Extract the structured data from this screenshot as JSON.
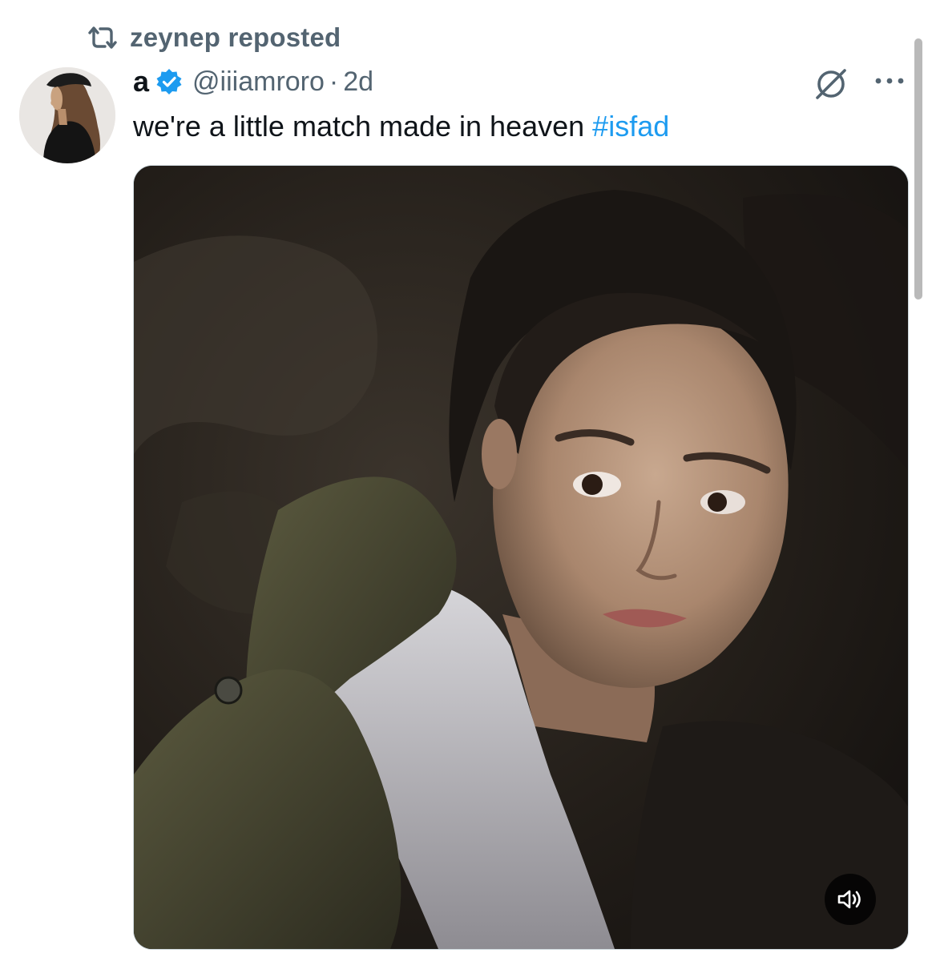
{
  "repost": {
    "icon": "repost-icon",
    "text": "zeynep reposted"
  },
  "tweet": {
    "display_name": "a",
    "verified_icon": "verified-badge-icon",
    "handle": "@iiiamroro",
    "separator": "·",
    "time": "2d",
    "text_main": "we're a little match made in heaven ",
    "hashtag": "#isfad",
    "actions": {
      "grok_icon": "grok-icon",
      "more_icon": "more-icon"
    },
    "media": {
      "type": "video",
      "mute_icon": "volume-icon"
    }
  },
  "colors": {
    "text_primary": "#0f1419",
    "text_secondary": "#536471",
    "accent": "#1d9bf0"
  }
}
